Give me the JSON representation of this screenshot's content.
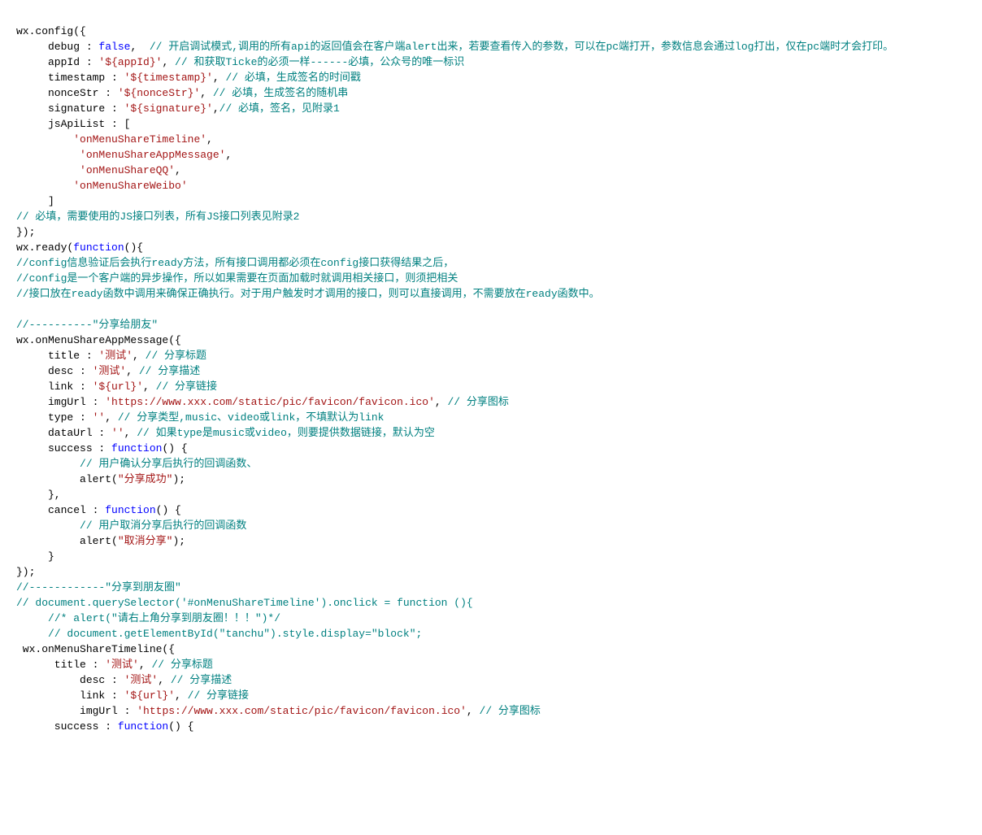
{
  "code_lines": [
    [
      {
        "cls": "tok-default",
        "text": "wx.config({"
      }
    ],
    [
      {
        "cls": "tok-default",
        "text": "     debug : "
      },
      {
        "cls": "tok-keyword",
        "text": "false"
      },
      {
        "cls": "tok-default",
        "text": ",  "
      },
      {
        "cls": "tok-comment",
        "text": "// 开启调试模式,调用的所有api的返回值会在客户端alert出来，若要查看传入的参数，可以在pc端打开，参数信息会通过log打出，仅在pc端时才会打印。"
      }
    ],
    [
      {
        "cls": "tok-default",
        "text": "     appId : "
      },
      {
        "cls": "tok-string",
        "text": "'${appId}'"
      },
      {
        "cls": "tok-default",
        "text": ", "
      },
      {
        "cls": "tok-comment",
        "text": "// 和获取Ticke的必须一样------必填，公众号的唯一标识"
      }
    ],
    [
      {
        "cls": "tok-default",
        "text": "     timestamp : "
      },
      {
        "cls": "tok-string",
        "text": "'${timestamp}'"
      },
      {
        "cls": "tok-default",
        "text": ", "
      },
      {
        "cls": "tok-comment",
        "text": "// 必填，生成签名的时间戳"
      }
    ],
    [
      {
        "cls": "tok-default",
        "text": "     nonceStr : "
      },
      {
        "cls": "tok-string",
        "text": "'${nonceStr}'"
      },
      {
        "cls": "tok-default",
        "text": ", "
      },
      {
        "cls": "tok-comment",
        "text": "// 必填，生成签名的随机串"
      }
    ],
    [
      {
        "cls": "tok-default",
        "text": "     signature : "
      },
      {
        "cls": "tok-string",
        "text": "'${signature}'"
      },
      {
        "cls": "tok-default",
        "text": ","
      },
      {
        "cls": "tok-comment",
        "text": "// 必填，签名，见附录1"
      }
    ],
    [
      {
        "cls": "tok-default",
        "text": "     jsApiList : ["
      }
    ],
    [
      {
        "cls": "tok-default",
        "text": "         "
      },
      {
        "cls": "tok-string",
        "text": "'onMenuShareTimeline'"
      },
      {
        "cls": "tok-default",
        "text": ","
      }
    ],
    [
      {
        "cls": "tok-default",
        "text": "          "
      },
      {
        "cls": "tok-string",
        "text": "'onMenuShareAppMessage'"
      },
      {
        "cls": "tok-default",
        "text": ","
      }
    ],
    [
      {
        "cls": "tok-default",
        "text": "          "
      },
      {
        "cls": "tok-string",
        "text": "'onMenuShareQQ'"
      },
      {
        "cls": "tok-default",
        "text": ","
      }
    ],
    [
      {
        "cls": "tok-default",
        "text": "         "
      },
      {
        "cls": "tok-string",
        "text": "'onMenuShareWeibo'"
      }
    ],
    [
      {
        "cls": "tok-default",
        "text": "     ]"
      }
    ],
    [
      {
        "cls": "tok-comment",
        "text": "// 必填，需要使用的JS接口列表，所有JS接口列表见附录2"
      }
    ],
    [
      {
        "cls": "tok-default",
        "text": "});"
      }
    ],
    [
      {
        "cls": "tok-default",
        "text": "wx.ready("
      },
      {
        "cls": "tok-keyword",
        "text": "function"
      },
      {
        "cls": "tok-default",
        "text": "(){"
      }
    ],
    [
      {
        "cls": "tok-comment",
        "text": "//config信息验证后会执行ready方法，所有接口调用都必须在config接口获得结果之后，"
      }
    ],
    [
      {
        "cls": "tok-comment",
        "text": "//config是一个客户端的异步操作，所以如果需要在页面加载时就调用相关接口，则须把相关"
      }
    ],
    [
      {
        "cls": "tok-comment",
        "text": "//接口放在ready函数中调用来确保正确执行。对于用户触发时才调用的接口，则可以直接调用，不需要放在ready函数中。"
      }
    ],
    [
      {
        "cls": "tok-default",
        "text": ""
      }
    ],
    [
      {
        "cls": "tok-comment",
        "text": "//----------\"分享给朋友\""
      }
    ],
    [
      {
        "cls": "tok-default",
        "text": "wx.onMenuShareAppMessage({"
      }
    ],
    [
      {
        "cls": "tok-default",
        "text": "     title : "
      },
      {
        "cls": "tok-string",
        "text": "'测试'"
      },
      {
        "cls": "tok-default",
        "text": ", "
      },
      {
        "cls": "tok-comment",
        "text": "// 分享标题"
      }
    ],
    [
      {
        "cls": "tok-default",
        "text": "     desc : "
      },
      {
        "cls": "tok-string",
        "text": "'测试'"
      },
      {
        "cls": "tok-default",
        "text": ", "
      },
      {
        "cls": "tok-comment",
        "text": "// 分享描述"
      }
    ],
    [
      {
        "cls": "tok-default",
        "text": "     link : "
      },
      {
        "cls": "tok-string",
        "text": "'${url}'"
      },
      {
        "cls": "tok-default",
        "text": ", "
      },
      {
        "cls": "tok-comment",
        "text": "// 分享链接"
      }
    ],
    [
      {
        "cls": "tok-default",
        "text": "     imgUrl : "
      },
      {
        "cls": "tok-string",
        "text": "'https://www.xxx.com/static/pic/favicon/favicon.ico'"
      },
      {
        "cls": "tok-default",
        "text": ", "
      },
      {
        "cls": "tok-comment",
        "text": "// 分享图标"
      }
    ],
    [
      {
        "cls": "tok-default",
        "text": "     type : "
      },
      {
        "cls": "tok-string",
        "text": "''"
      },
      {
        "cls": "tok-default",
        "text": ", "
      },
      {
        "cls": "tok-comment",
        "text": "// 分享类型,music、video或link，不填默认为link"
      }
    ],
    [
      {
        "cls": "tok-default",
        "text": "     dataUrl : "
      },
      {
        "cls": "tok-string",
        "text": "''"
      },
      {
        "cls": "tok-default",
        "text": ", "
      },
      {
        "cls": "tok-comment",
        "text": "// 如果type是music或video，则要提供数据链接，默认为空"
      }
    ],
    [
      {
        "cls": "tok-default",
        "text": "     success : "
      },
      {
        "cls": "tok-keyword",
        "text": "function"
      },
      {
        "cls": "tok-default",
        "text": "() {"
      }
    ],
    [
      {
        "cls": "tok-default",
        "text": "          "
      },
      {
        "cls": "tok-comment",
        "text": "// 用户确认分享后执行的回调函数、"
      }
    ],
    [
      {
        "cls": "tok-default",
        "text": "          alert("
      },
      {
        "cls": "tok-string",
        "text": "\"分享成功\""
      },
      {
        "cls": "tok-default",
        "text": ");"
      }
    ],
    [
      {
        "cls": "tok-default",
        "text": "     },"
      }
    ],
    [
      {
        "cls": "tok-default",
        "text": "     cancel : "
      },
      {
        "cls": "tok-keyword",
        "text": "function"
      },
      {
        "cls": "tok-default",
        "text": "() {"
      }
    ],
    [
      {
        "cls": "tok-default",
        "text": "          "
      },
      {
        "cls": "tok-comment",
        "text": "// 用户取消分享后执行的回调函数"
      }
    ],
    [
      {
        "cls": "tok-default",
        "text": "          alert("
      },
      {
        "cls": "tok-string",
        "text": "\"取消分享\""
      },
      {
        "cls": "tok-default",
        "text": ");"
      }
    ],
    [
      {
        "cls": "tok-default",
        "text": "     }"
      }
    ],
    [
      {
        "cls": "tok-default",
        "text": "});"
      }
    ],
    [
      {
        "cls": "tok-comment",
        "text": "//------------\"分享到朋友圈\""
      }
    ],
    [
      {
        "cls": "tok-comment",
        "text": "// document.querySelector('#onMenuShareTimeline').onclick = function (){"
      }
    ],
    [
      {
        "cls": "tok-default",
        "text": "     "
      },
      {
        "cls": "tok-comment",
        "text": "//* alert(\"请右上角分享到朋友圈！！！\")*/"
      }
    ],
    [
      {
        "cls": "tok-default",
        "text": "     "
      },
      {
        "cls": "tok-comment",
        "text": "// document.getElementById(\"tanchu\").style.display=\"block\";"
      }
    ],
    [
      {
        "cls": "tok-default",
        "text": " wx.onMenuShareTimeline({"
      }
    ],
    [
      {
        "cls": "tok-default",
        "text": "      title : "
      },
      {
        "cls": "tok-string",
        "text": "'测试'"
      },
      {
        "cls": "tok-default",
        "text": ", "
      },
      {
        "cls": "tok-comment",
        "text": "// 分享标题"
      }
    ],
    [
      {
        "cls": "tok-default",
        "text": "          desc : "
      },
      {
        "cls": "tok-string",
        "text": "'测试'"
      },
      {
        "cls": "tok-default",
        "text": ", "
      },
      {
        "cls": "tok-comment",
        "text": "// 分享描述"
      }
    ],
    [
      {
        "cls": "tok-default",
        "text": "          link : "
      },
      {
        "cls": "tok-string",
        "text": "'${url}'"
      },
      {
        "cls": "tok-default",
        "text": ", "
      },
      {
        "cls": "tok-comment",
        "text": "// 分享链接"
      }
    ],
    [
      {
        "cls": "tok-default",
        "text": "          imgUrl : "
      },
      {
        "cls": "tok-string",
        "text": "'https://www.xxx.com/static/pic/favicon/favicon.ico'"
      },
      {
        "cls": "tok-default",
        "text": ", "
      },
      {
        "cls": "tok-comment",
        "text": "// 分享图标"
      }
    ],
    [
      {
        "cls": "tok-default",
        "text": "      success : "
      },
      {
        "cls": "tok-keyword",
        "text": "function"
      },
      {
        "cls": "tok-default",
        "text": "() {"
      }
    ]
  ]
}
